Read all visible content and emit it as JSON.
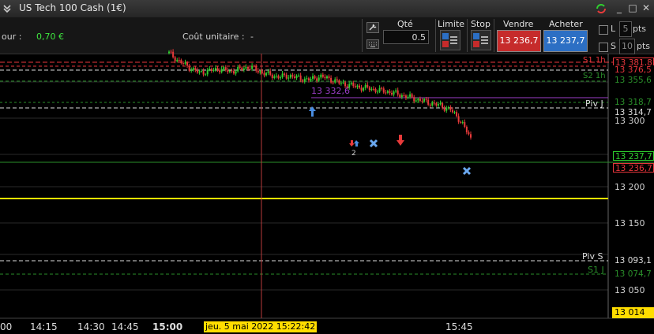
{
  "window": {
    "title": "US Tech 100 Cash (1€)"
  },
  "toolbar": {
    "jour_label": "our :",
    "jour_value": "0,70 €",
    "cout_label": "Coût unitaire :",
    "cout_value": "-",
    "qty_label": "Qté",
    "qty_value": "0.5",
    "limite_label": "Limite",
    "stop_label": "Stop",
    "sell_label": "Vendre",
    "sell_price": "13 236,7",
    "buy_label": "Acheter",
    "buy_price": "13 237,7",
    "l_label": "L",
    "l_value": "5",
    "l_unit": "pts",
    "s_label": "S",
    "s_value": "10",
    "s_unit": "pts"
  },
  "levels": {
    "s1h_label": "S1 1h",
    "s1h_value": "13 381,8",
    "s1h_value2": "13 376,5",
    "s2h_label": "S2 1h",
    "s2h_value": "13 355,6",
    "purple_value": "13 332,6",
    "pivj_label": "Piv J",
    "pivj_value": "13 318,7",
    "pivj_value2": "13 314,7",
    "ask_value": "13 237,7",
    "bid_value": "13 236,7",
    "pivs_label": "Piv S",
    "pivs_value": "13 093,1",
    "s1j_label": "S1 J",
    "s1j_value": "13 074,7",
    "marker_count": "2",
    "cursor_price": "13 014"
  },
  "price_axis": [
    "13 300",
    "13 200",
    "13 150",
    "13 050"
  ],
  "time_axis": [
    "00",
    "14:15",
    "14:30",
    "14:45",
    "15:00",
    "15:45"
  ],
  "cursor_date": "jeu. 5 mai 2022 15:22:42",
  "colors": {
    "bull": "#2fd12f",
    "bear": "#e83a3a",
    "resistance": "#e8363c",
    "support": "#2a8f2a",
    "pivot": "#cfcfcf",
    "highlight": "#ffee00",
    "purple": "#9b3ec8"
  },
  "chart_data": {
    "type": "candlestick",
    "instrument": "US Tech 100 Cash (1€)",
    "x": [
      "14:59",
      "15:00",
      "15:02",
      "15:04",
      "15:06",
      "15:08",
      "15:10",
      "15:12",
      "15:14",
      "15:16",
      "15:18",
      "15:20",
      "15:22",
      "15:24",
      "15:26",
      "15:28",
      "15:30",
      "15:32",
      "15:34",
      "15:36",
      "15:38",
      "15:40",
      "15:42",
      "15:44",
      "15:46",
      "15:48",
      "15:50",
      "15:52",
      "15:54",
      "15:56",
      "15:58"
    ],
    "close": [
      13395,
      13383,
      13374,
      13366,
      13369,
      13372,
      13368,
      13371,
      13375,
      13368,
      13363,
      13360,
      13362,
      13358,
      13356,
      13361,
      13357,
      13351,
      13348,
      13345,
      13343,
      13340,
      13338,
      13334,
      13330,
      13326,
      13322,
      13318,
      13312,
      13296,
      13270
    ],
    "ylim": [
      13000,
      13410
    ],
    "reference_lines": [
      13381.8,
      13376.5,
      13355.6,
      13332.6,
      13318.7,
      13314.7,
      13237.7,
      13236.7,
      13093.1,
      13074.7
    ]
  }
}
